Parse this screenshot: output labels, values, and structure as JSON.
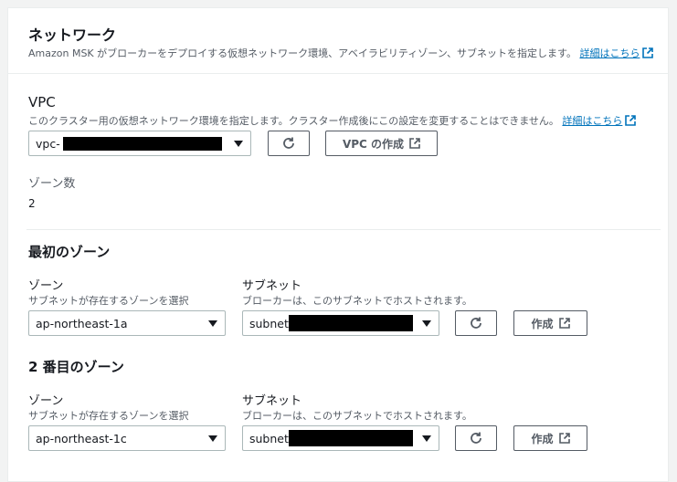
{
  "network": {
    "title": "ネットワーク",
    "description": "Amazon MSK がブローカーをデプロイする仮想ネットワーク環境、アベイラビリティゾーン、サブネットを指定します。",
    "learn_more": "詳細はこちら"
  },
  "vpc": {
    "label": "VPC",
    "description": "このクラスター用の仮想ネットワーク環境を指定します。クラスター作成後にこの設定を変更することはできません。",
    "learn_more": "詳細はこちら",
    "selected_prefix": "vpc-",
    "create_button": "VPC の作成"
  },
  "zone_count": {
    "label": "ゾーン数",
    "value": "2"
  },
  "zones": [
    {
      "title": "最初のゾーン",
      "zone_label": "ゾーン",
      "zone_desc": "サブネットが存在するゾーンを選択",
      "zone_value": "ap-northeast-1a",
      "subnet_label": "サブネット",
      "subnet_desc": "ブローカーは、このサブネットでホストされます。",
      "subnet_prefix": "subnet-",
      "create_button": "作成"
    },
    {
      "title": "2 番目のゾーン",
      "zone_label": "ゾーン",
      "zone_desc": "サブネットが存在するゾーンを選択",
      "zone_value": "ap-northeast-1c",
      "subnet_label": "サブネット",
      "subnet_desc": "ブローカーは、このサブネットでホストされます。",
      "subnet_prefix": "subnet-",
      "create_button": "作成"
    }
  ],
  "colors": {
    "link": "#0073bb",
    "border": "#aab7b8",
    "text": "#16191f",
    "muted": "#545b64"
  }
}
